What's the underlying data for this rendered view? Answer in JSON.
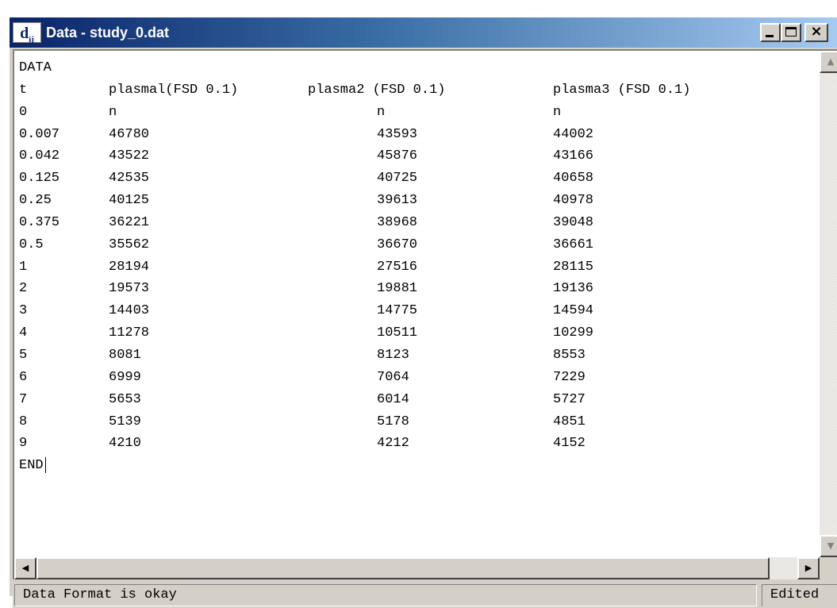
{
  "window": {
    "icon_main": "d",
    "icon_sub": "ij",
    "title": "Data - study_0.dat",
    "controls": [
      "minimize-icon",
      "maximize-icon",
      "close-icon"
    ],
    "close_glyph": "×"
  },
  "editor": {
    "lines": {
      "l0": {
        "c0": "DATA"
      },
      "l1": {
        "c0": "t",
        "c1": "plasmal(FSD 0.1)",
        "c2": "plasma2 (FSD 0.1)",
        "c3": "plasma3 (FSD 0.1)"
      },
      "l2": {
        "c0": "0",
        "c1": "n",
        "c2": "n",
        "c3": "n"
      },
      "rows": [
        {
          "t": "0.007",
          "p1": "46780",
          "p2": "43593",
          "p3": "44002"
        },
        {
          "t": "0.042",
          "p1": "43522",
          "p2": "45876",
          "p3": "43166"
        },
        {
          "t": "0.125",
          "p1": "42535",
          "p2": "40725",
          "p3": "40658"
        },
        {
          "t": "0.25",
          "p1": "40125",
          "p2": "39613",
          "p3": "40978"
        },
        {
          "t": "0.375",
          "p1": "36221",
          "p2": "38968",
          "p3": "39048"
        },
        {
          "t": "0.5",
          "p1": "35562",
          "p2": "36670",
          "p3": "36661"
        },
        {
          "t": "1",
          "p1": "28194",
          "p2": "27516",
          "p3": "28115"
        },
        {
          "t": "2",
          "p1": "19573",
          "p2": "19881",
          "p3": "19136"
        },
        {
          "t": "3",
          "p1": "14403",
          "p2": "14775",
          "p3": "14594"
        },
        {
          "t": "4",
          "p1": "11278",
          "p2": "10511",
          "p3": "10299"
        },
        {
          "t": "5",
          "p1": "8081",
          "p2": "8123",
          "p3": "8553"
        },
        {
          "t": "6",
          "p1": "6999",
          "p2": "7064",
          "p3": "7229"
        },
        {
          "t": "7",
          "p1": "5653",
          "p2": "6014",
          "p3": "5727"
        },
        {
          "t": "8",
          "p1": "5139",
          "p2": "5178",
          "p3": "4851"
        },
        {
          "t": "9",
          "p1": "4210",
          "p2": "4212",
          "p3": "4152"
        }
      ],
      "end": "END"
    }
  },
  "scrollbars": {
    "up_arrow": "▲",
    "down_arrow": "▼",
    "left_arrow": "◀",
    "right_arrow": "▶"
  },
  "status": {
    "message": "Data Format is okay",
    "state": "Edited"
  },
  "colors": {
    "title_gradient_start": "#0a246a",
    "title_gradient_end": "#a6caf0",
    "chrome": "#d4d0c8"
  }
}
